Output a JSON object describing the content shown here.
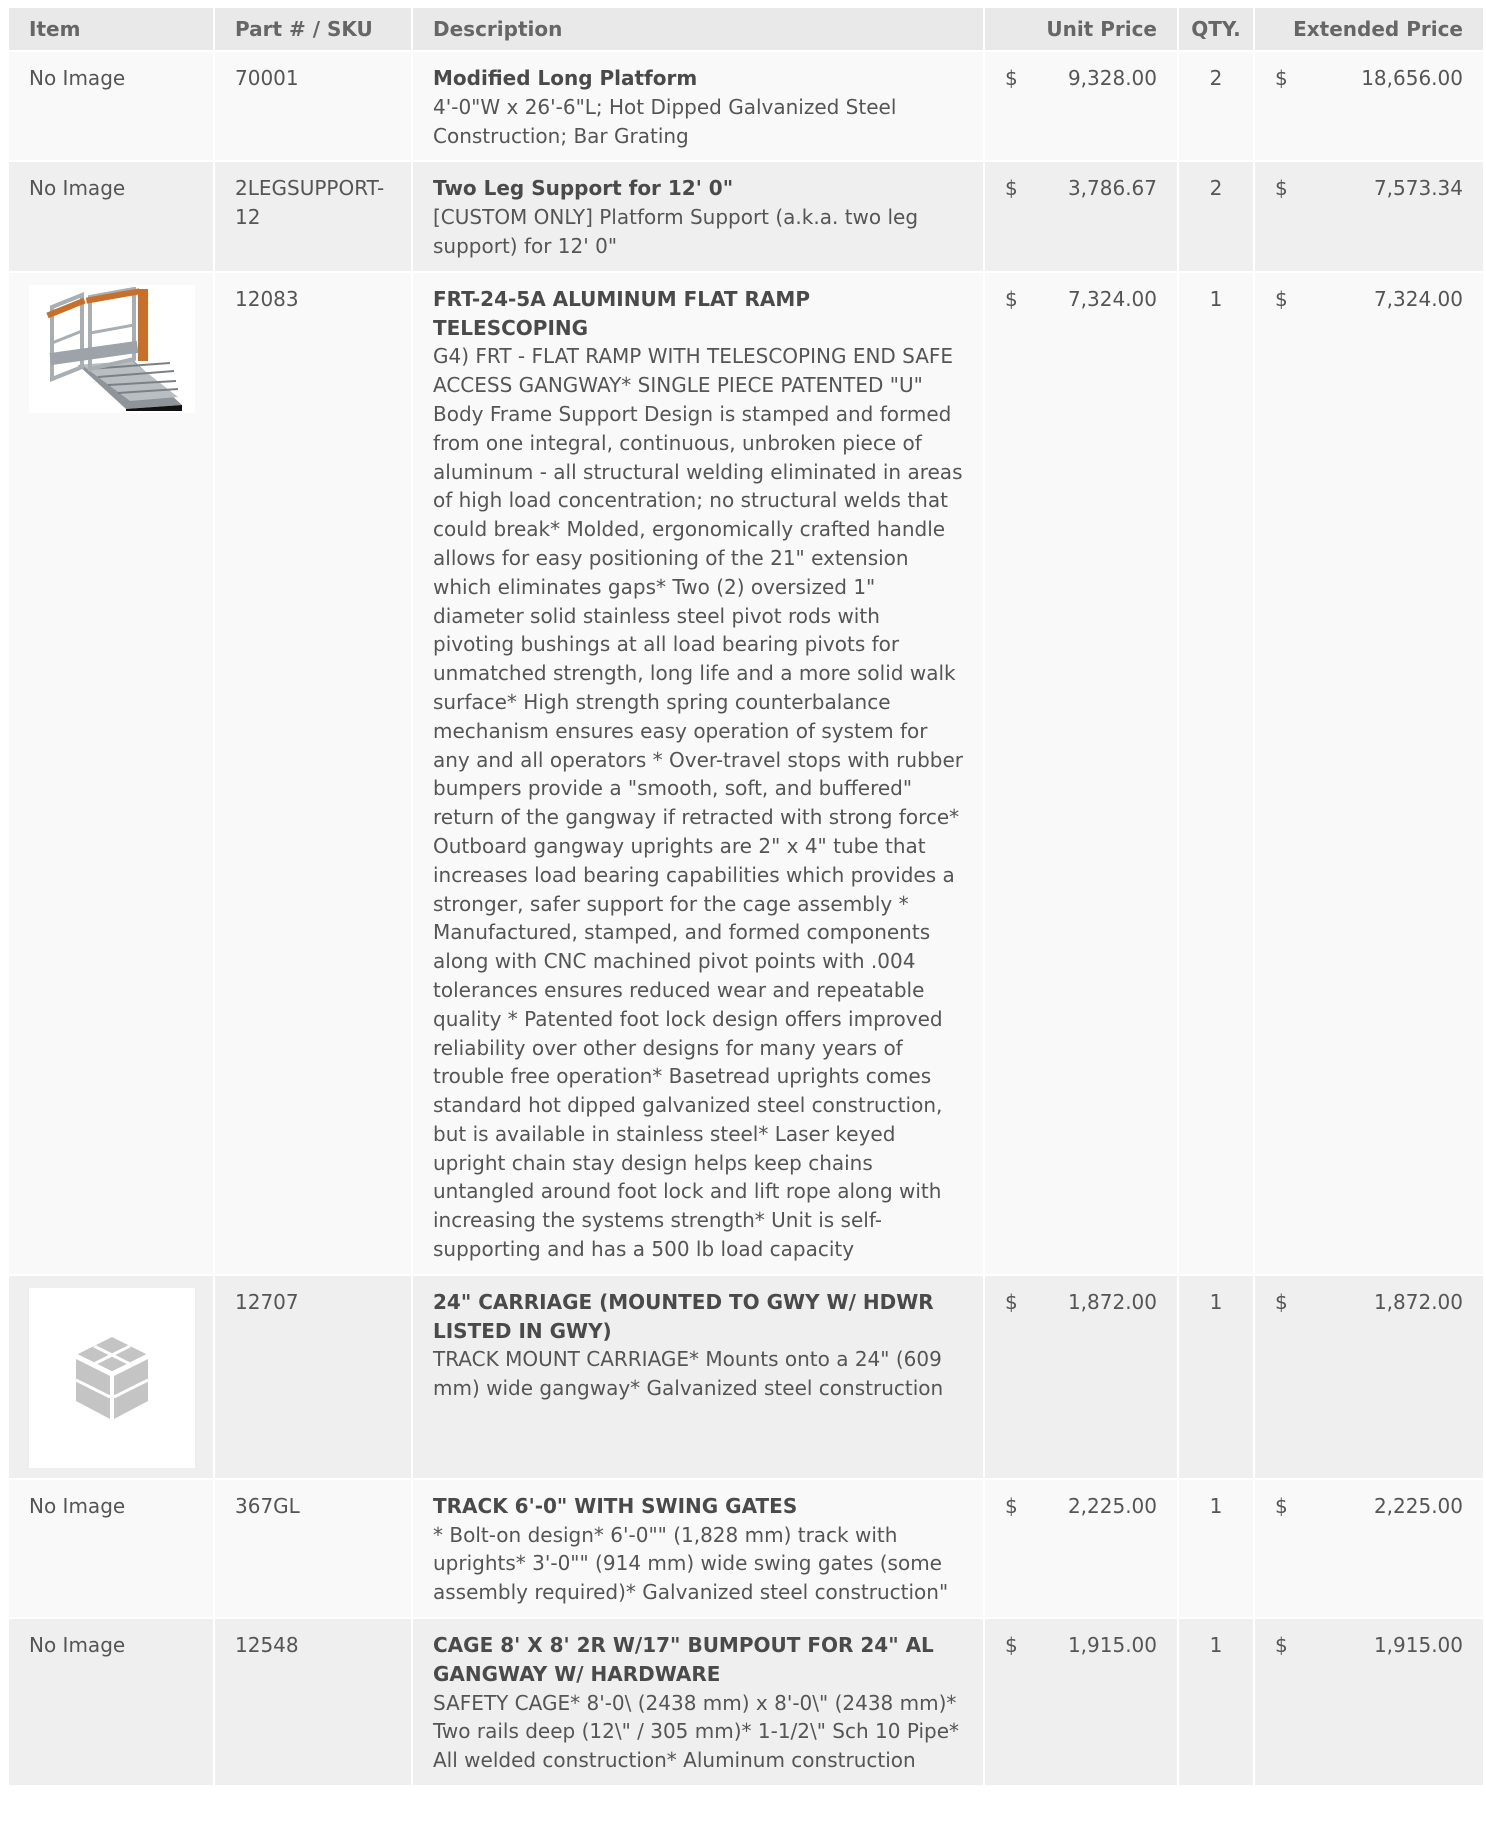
{
  "headers": {
    "item": "Item",
    "part": "Part # / SKU",
    "description": "Description",
    "unit_price": "Unit Price",
    "qty": "QTY.",
    "extended_price": "Extended Price"
  },
  "currency_symbol": "$",
  "rows": [
    {
      "item": "No Image",
      "part": "70001",
      "title": "Modified Long Platform",
      "description": "4'-0\"W x 26'-6\"L; Hot Dipped Galvanized Steel Construction; Bar Grating",
      "unit_price": "9,328.00",
      "qty": "2",
      "extended_price": "18,656.00"
    },
    {
      "item": "No Image",
      "part": "2LEGSUPPORT-12",
      "title": "Two Leg Support for 12' 0\"",
      "description": "[CUSTOM ONLY] Platform Support (a.k.a. two leg support) for 12' 0\"",
      "unit_price": "3,786.67",
      "qty": "2",
      "extended_price": "7,573.34"
    },
    {
      "item_image": "gangway-ramp-photo",
      "part": "12083",
      "title": "FRT-24-5A ALUMINUM FLAT RAMP TELESCOPING",
      "description": "G4) FRT - FLAT RAMP WITH TELESCOPING END SAFE ACCESS GANGWAY* SINGLE PIECE PATENTED \"U\" Body Frame Support Design is stamped and formed from one integral, continuous, unbroken piece of aluminum - all structural welding eliminated in areas of high load concentration; no structural welds that could break* Molded, ergonomically crafted handle allows for easy positioning of the 21\" extension which eliminates gaps* Two (2) oversized 1\" diameter solid stainless steel pivot rods with pivoting bushings at all load bearing pivots for unmatched strength, long life and a more solid walk surface* High strength spring counterbalance mechanism ensures easy operation of system for any and all operators * Over-travel stops with rubber bumpers provide a \"smooth, soft, and buffered\" return of the gangway if retracted with strong force* Outboard gangway uprights are 2\" x 4\" tube that increases load bearing capabilities which provides a stronger, safer support for the cage assembly * Manufactured, stamped, and formed components along with CNC machined pivot points with .004 tolerances ensures reduced wear and repeatable quality * Patented foot lock design offers improved reliability over other designs for many years of trouble free operation* Basetread uprights comes standard hot dipped galvanized steel construction, but is available in stainless steel* Laser keyed upright chain stay design helps keep chains untangled around foot lock and lift rope along with increasing the systems strength* Unit is self-supporting and has a 500 lb load capacity",
      "unit_price": "7,324.00",
      "qty": "1",
      "extended_price": "7,324.00"
    },
    {
      "item_image": "placeholder-box-icon",
      "part": "12707",
      "title": "24\" CARRIAGE (MOUNTED TO GWY W/ HDWR LISTED IN GWY)",
      "description": "TRACK MOUNT CARRIAGE* Mounts onto a 24\" (609 mm) wide gangway* Galvanized steel construction",
      "unit_price": "1,872.00",
      "qty": "1",
      "extended_price": "1,872.00"
    },
    {
      "item": "No Image",
      "part": "367GL",
      "title": "TRACK 6'-0\" WITH SWING GATES",
      "description": "* Bolt-on design* 6'-0\"\" (1,828 mm) track with uprights* 3'-0\"\" (914 mm) wide swing gates (some assembly required)* Galvanized steel construction\"",
      "unit_price": "2,225.00",
      "qty": "1",
      "extended_price": "2,225.00"
    },
    {
      "item": "No Image",
      "part": "12548",
      "title": "CAGE 8' X 8' 2R W/17\" BUMPOUT FOR 24\" AL GANGWAY W/ HARDWARE",
      "description": "SAFETY CAGE* 8'-0\\ (2438 mm) x 8'-0\\\" (2438 mm)* Two rails deep (12\\\" / 305 mm)* 1-1/2\\\" Sch 10 Pipe* All welded construction* Aluminum construction",
      "unit_price": "1,915.00",
      "qty": "1",
      "extended_price": "1,915.00"
    }
  ]
}
